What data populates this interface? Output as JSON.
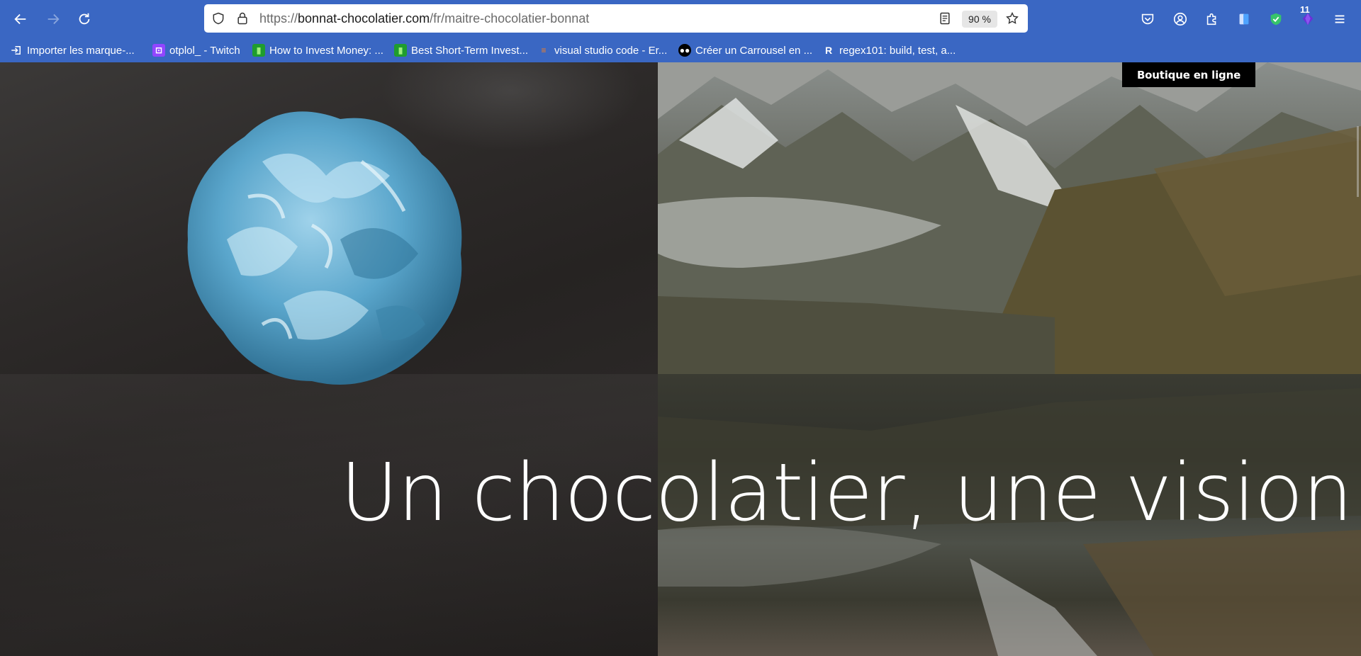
{
  "browser": {
    "url_prefix": "https://",
    "url_domain": "bonnat-chocolatier.com",
    "url_path": "/fr/maitre-chocolatier-bonnat",
    "zoom": "90 %",
    "extension_badge": "11"
  },
  "bookmarks": [
    {
      "label": "Importer les marque-...",
      "icon": "import-icon"
    },
    {
      "label": "otplol_ - Twitch",
      "icon": "twitch-icon"
    },
    {
      "label": "How to Invest Money: ...",
      "icon": "nerdwallet-icon"
    },
    {
      "label": "Best Short-Term Invest...",
      "icon": "nerdwallet-icon"
    },
    {
      "label": "visual studio code - Er...",
      "icon": "stackoverflow-icon"
    },
    {
      "label": "Créer un Carrousel en ...",
      "icon": "medium-icon"
    },
    {
      "label": "regex101: build, test, a...",
      "icon": "regex101-icon"
    }
  ],
  "page": {
    "shop_button": "Boutique en ligne",
    "hero_title": "Un chocolatier, une vision."
  },
  "colors": {
    "chrome": "#3a67c3",
    "truffle": "#6fb4d6",
    "shop_button_bg": "#000000"
  }
}
